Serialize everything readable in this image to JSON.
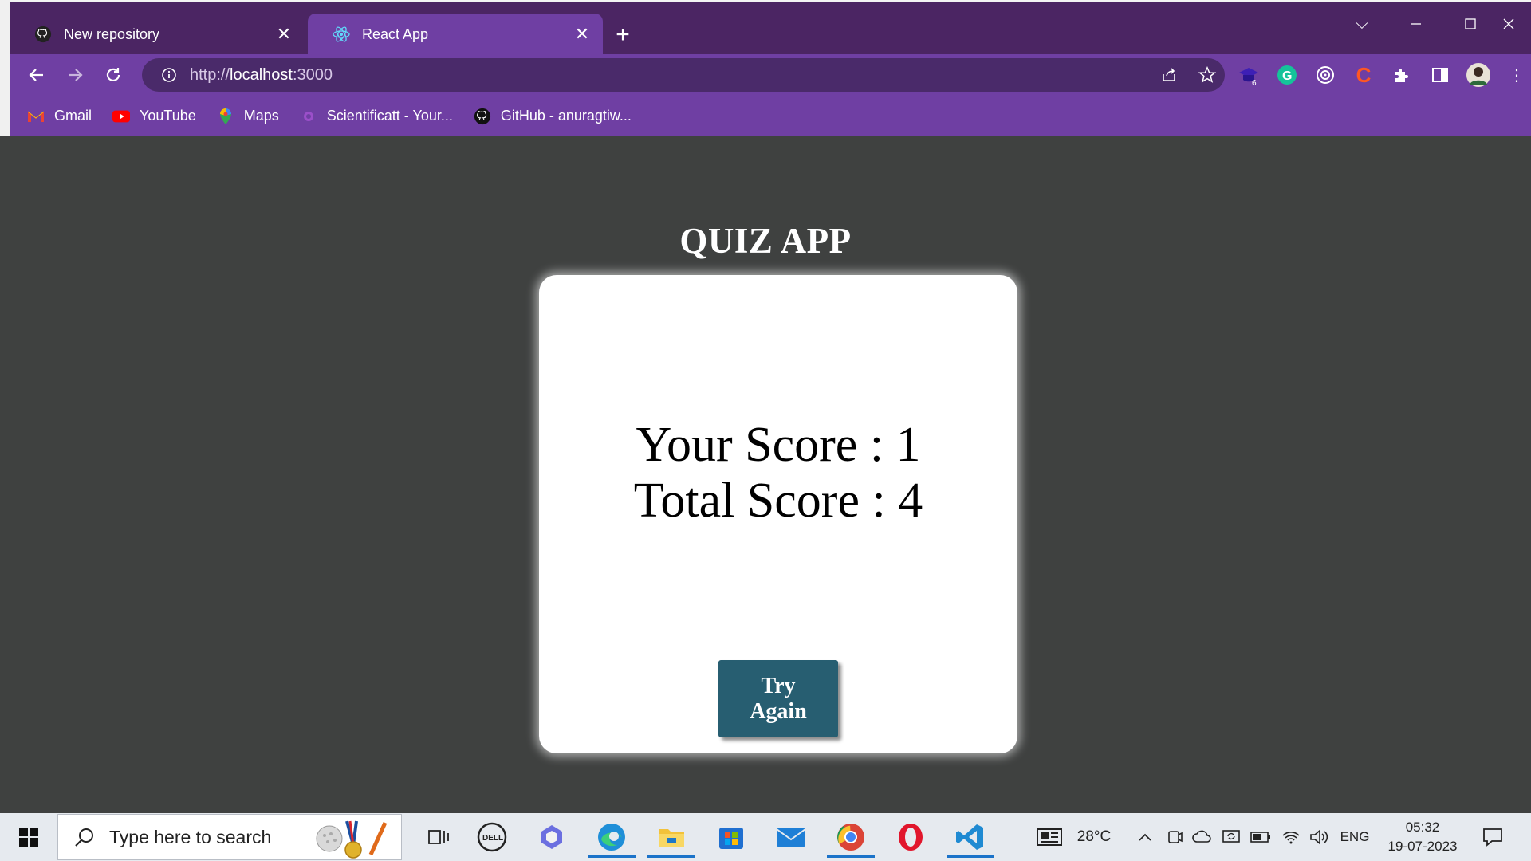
{
  "browser": {
    "tabs": [
      {
        "title": "New repository",
        "icon": "github-icon"
      },
      {
        "title": "React App",
        "icon": "react-icon",
        "active": true
      }
    ],
    "url_scheme": "http://",
    "url_host": "localhost",
    "url_port": ":3000",
    "bookmarks": [
      {
        "label": "Gmail",
        "icon": "gmail-icon"
      },
      {
        "label": "YouTube",
        "icon": "youtube-icon"
      },
      {
        "label": "Maps",
        "icon": "maps-icon"
      },
      {
        "label": "Scientificatt - Your...",
        "icon": "scientificatt-icon"
      },
      {
        "label": "GitHub - anuragtiw...",
        "icon": "github-icon"
      }
    ],
    "extension_badge": "6",
    "colors": {
      "frame": "#4b2563",
      "toolbar": "#6f3fa3",
      "omnibox": "#4a2a6a"
    }
  },
  "page": {
    "title": "QUIZ APP",
    "score_label": "Your Score : 1",
    "total_label": "Total Score : 4",
    "button_line1": "Try",
    "button_line2": "Again",
    "colors": {
      "background": "#3f4140",
      "card": "#ffffff",
      "button": "#275e71"
    }
  },
  "taskbar": {
    "search_placeholder": "Type here to search",
    "weather": "28°C",
    "language": "ENG",
    "time": "05:32",
    "date": "19-07-2023"
  }
}
